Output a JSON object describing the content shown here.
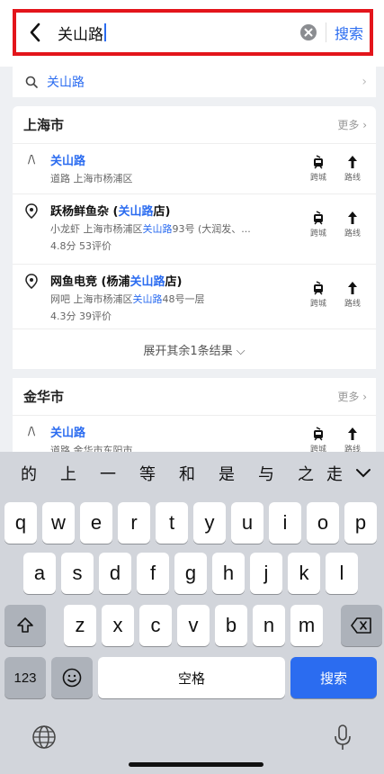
{
  "search": {
    "query": "关山路",
    "button": "搜索"
  },
  "suggestion": {
    "text": "关山路"
  },
  "groups": [
    {
      "city": "上海市",
      "more": "更多",
      "results": [
        {
          "title": "关山路",
          "title_hl": "",
          "title_pre": "",
          "title_post": "",
          "sub": "道路 上海市杨浦区",
          "sub_hl": "",
          "sub_post": "",
          "rating": ""
        },
        {
          "title_pre": "跃杨鲜鱼杂 (",
          "title_hl": "关山路",
          "title_post": "店)",
          "sub_pre": "小龙虾  上海市杨浦区",
          "sub_hl": "关山路",
          "sub_post": "93号 (大润发、...",
          "rating": "4.8分  53评价"
        },
        {
          "title_pre": "网鱼电竞 (杨浦",
          "title_hl": "关山路",
          "title_post": "店)",
          "sub_pre": "网吧  上海市杨浦区",
          "sub_hl": "关山路",
          "sub_post": "48号一层",
          "rating": "4.3分  39评价"
        }
      ],
      "expand": "展开其余1条结果 ⌵"
    },
    {
      "city": "金华市",
      "more": "更多",
      "results": [
        {
          "title": "关山路",
          "sub": "道路 金华市东阳市"
        }
      ]
    }
  ],
  "actions": {
    "cross_city": "跨城",
    "route": "路线"
  },
  "keyboard": {
    "candidates": [
      "的",
      "上",
      "一",
      "等",
      "和",
      "是",
      "与",
      "之",
      "走"
    ],
    "row1": [
      "q",
      "w",
      "e",
      "r",
      "t",
      "y",
      "u",
      "i",
      "o",
      "p"
    ],
    "row2": [
      "a",
      "s",
      "d",
      "f",
      "g",
      "h",
      "j",
      "k",
      "l"
    ],
    "row3": [
      "z",
      "x",
      "c",
      "v",
      "b",
      "n",
      "m"
    ],
    "num_key": "123",
    "space_key": "空格",
    "enter_key": "搜索"
  }
}
